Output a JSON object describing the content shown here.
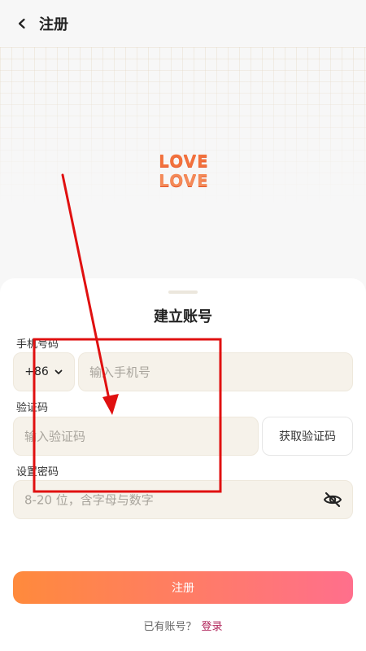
{
  "header": {
    "title": "注册",
    "back_icon": "chevron-left-icon"
  },
  "hero": {
    "logo_line1": "LOVE",
    "logo_line2": "LOVE",
    "logo_color": "#f2713c"
  },
  "sheet": {
    "title": "建立账号",
    "phone": {
      "label": "手机号码",
      "country_code": "+86",
      "placeholder": "输入手机号"
    },
    "code": {
      "label": "验证码",
      "placeholder": "输入验证码",
      "button": "获取验证码"
    },
    "password": {
      "label": "设置密码",
      "placeholder": "8-20 位，含字母与数字",
      "visibility_icon": "eye-off-icon"
    },
    "submit_label": "注册",
    "footer": {
      "prompt": "已有账号？",
      "link": "登录"
    }
  },
  "colors": {
    "accent_start": "#ff8a3c",
    "accent_end": "#ff6f8c",
    "link": "#b0245a",
    "field_bg": "#f6f2ea",
    "annotation": "#e01010"
  }
}
